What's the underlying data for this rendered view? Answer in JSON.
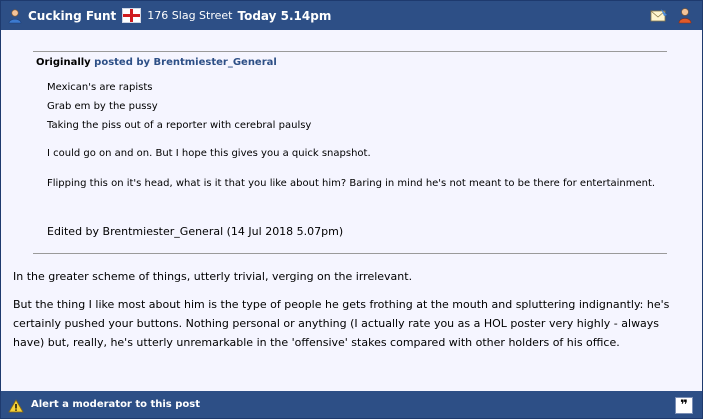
{
  "header": {
    "username": "Cucking Funt",
    "location": "176 Slag Street",
    "timestamp": "Today 5.14pm"
  },
  "quote": {
    "prefix": "Originally",
    "posted_by": "posted by Brentmiester_General",
    "lines": [
      "Mexican's are rapists",
      "Grab em by the pussy",
      "Taking the piss out of a reporter with cerebral paulsy"
    ],
    "para1": "I could go on and on. But I hope this gives you a quick snapshot.",
    "para2": "Flipping this on it's head, what is it that you like about him? Baring in mind he's not meant to be there for entertainment.",
    "edited": "Edited by Brentmiester_General (14 Jul 2018 5.07pm)"
  },
  "reply": {
    "para1": "In the greater scheme of things, utterly trivial, verging on the irrelevant.",
    "para2": "But the thing I like most about him is the type of people he gets frothing at the mouth and spluttering indignantly: he's certainly pushed your buttons. Nothing personal or anything (I actually rate you as a HOL poster very highly - always have) but, really, he's utterly unremarkable in the 'offensive' stakes compared with other holders of his office."
  },
  "footer": {
    "alert_label": "Alert a moderator to this post",
    "quote_glyph": "❞"
  },
  "colors": {
    "bar": "#2d4f86",
    "background": "#f5f5ff",
    "link": "#2d4f86"
  },
  "icons": [
    "user-icon",
    "england-flag-icon",
    "private-message-icon",
    "user-profile-icon",
    "alert-triangle-icon",
    "quote-icon"
  ]
}
